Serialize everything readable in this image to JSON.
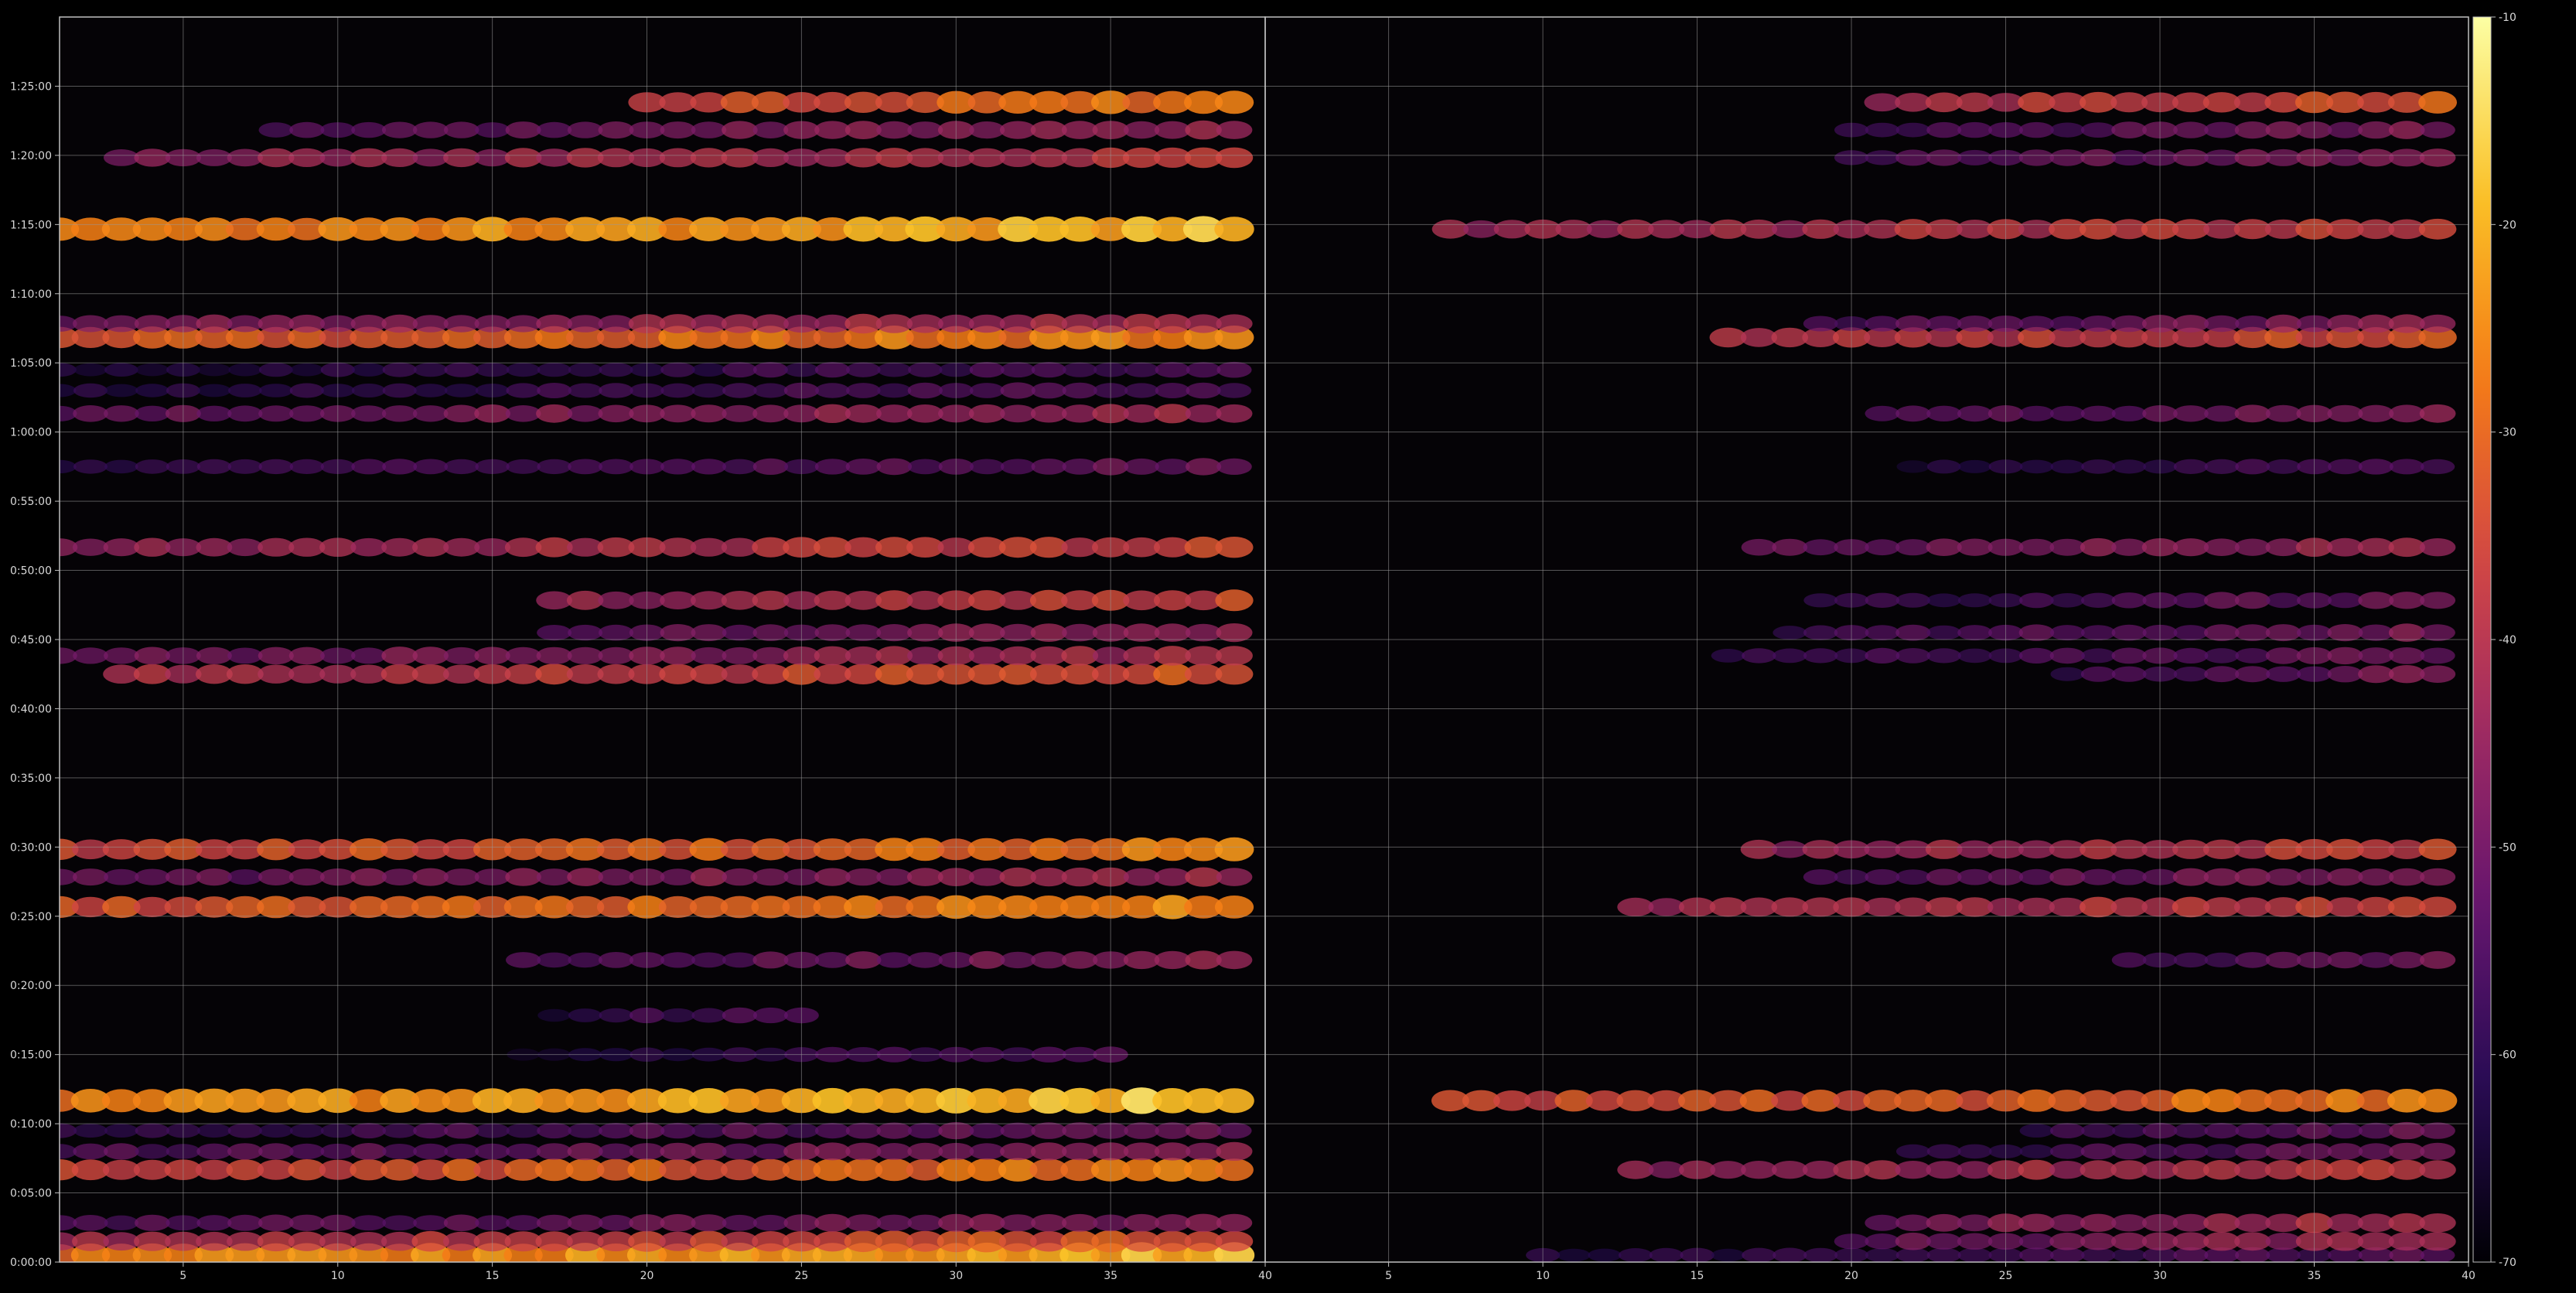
{
  "chart_data": {
    "type": "heatmap",
    "title": "",
    "colormap": "inferno",
    "colors": {
      "background": "#000000",
      "frame": "#bfbfbf",
      "grid": "#9a9a9a",
      "text": "#d8d8d8"
    },
    "grid": true,
    "y_axis": {
      "label": "",
      "range_seconds": [
        0,
        5400
      ],
      "tick_labels": [
        "0:00:00",
        "0:05:00",
        "0:10:00",
        "0:15:00",
        "0:20:00",
        "0:25:00",
        "0:30:00",
        "0:35:00",
        "0:40:00",
        "0:45:00",
        "0:50:00",
        "0:55:00",
        "1:00:00",
        "1:05:00",
        "1:10:00",
        "1:15:00",
        "1:20:00",
        "1:25:00"
      ]
    },
    "panels": [
      {
        "name": "",
        "x_range": [
          1,
          40
        ],
        "x_tick_labels": [
          "5",
          "10",
          "15",
          "20",
          "25",
          "30",
          "35",
          "40"
        ],
        "bands": [
          {
            "t": "0:00:30",
            "x": [
              1,
              39
            ],
            "level": -22
          },
          {
            "t": "0:01:30",
            "x": [
              1,
              39
            ],
            "level": -35
          },
          {
            "t": "0:02:50",
            "x": [
              1,
              39
            ],
            "level": -48
          },
          {
            "t": "0:06:40",
            "x": [
              1,
              39
            ],
            "level": -30
          },
          {
            "t": "0:08:00",
            "x": [
              1,
              39
            ],
            "level": -48
          },
          {
            "t": "0:09:30",
            "x": [
              1,
              39
            ],
            "level": -52
          },
          {
            "t": "0:11:40",
            "x": [
              1,
              39
            ],
            "level": -20
          },
          {
            "t": "0:15:00",
            "x": [
              16,
              35
            ],
            "level": -56
          },
          {
            "t": "0:17:50",
            "x": [
              17,
              25
            ],
            "level": -54
          },
          {
            "t": "0:21:50",
            "x": [
              16,
              39
            ],
            "level": -48
          },
          {
            "t": "0:25:40",
            "x": [
              1,
              39
            ],
            "level": -28
          },
          {
            "t": "0:27:50",
            "x": [
              1,
              39
            ],
            "level": -45
          },
          {
            "t": "0:29:50",
            "x": [
              1,
              39
            ],
            "level": -30
          },
          {
            "t": "0:42:30",
            "x": [
              3,
              39
            ],
            "level": -35
          },
          {
            "t": "0:43:50",
            "x": [
              1,
              39
            ],
            "level": -44
          },
          {
            "t": "0:45:30",
            "x": [
              17,
              39
            ],
            "level": -45
          },
          {
            "t": "0:47:50",
            "x": [
              17,
              39
            ],
            "level": -38
          },
          {
            "t": "0:51:40",
            "x": [
              1,
              39
            ],
            "level": -38
          },
          {
            "t": "0:57:30",
            "x": [
              1,
              39
            ],
            "level": -52
          },
          {
            "t": "1:01:20",
            "x": [
              1,
              39
            ],
            "level": -44
          },
          {
            "t": "1:03:00",
            "x": [
              1,
              39
            ],
            "level": -55
          },
          {
            "t": "1:04:30",
            "x": [
              1,
              39
            ],
            "level": -56
          },
          {
            "t": "1:06:50",
            "x": [
              1,
              39
            ],
            "level": -28
          },
          {
            "t": "1:07:50",
            "x": [
              1,
              39
            ],
            "level": -42
          },
          {
            "t": "1:14:40",
            "x": [
              1,
              39
            ],
            "level": -22
          },
          {
            "t": "1:19:50",
            "x": [
              3,
              39
            ],
            "level": -40
          },
          {
            "t": "1:21:50",
            "x": [
              8,
              39
            ],
            "level": -46
          },
          {
            "t": "1:23:50",
            "x": [
              20,
              39
            ],
            "level": -30
          }
        ]
      },
      {
        "name": "",
        "x_range": [
          1,
          40
        ],
        "x_tick_labels": [
          "5",
          "10",
          "15",
          "20",
          "25",
          "30",
          "35",
          "40"
        ],
        "bands": [
          {
            "t": "0:00:30",
            "x": [
              10,
              39
            ],
            "level": -55
          },
          {
            "t": "0:01:30",
            "x": [
              20,
              39
            ],
            "level": -45
          },
          {
            "t": "0:02:50",
            "x": [
              21,
              39
            ],
            "level": -42
          },
          {
            "t": "0:06:40",
            "x": [
              13,
              39
            ],
            "level": -40
          },
          {
            "t": "0:08:00",
            "x": [
              22,
              39
            ],
            "level": -52
          },
          {
            "t": "0:09:30",
            "x": [
              26,
              39
            ],
            "level": -52
          },
          {
            "t": "0:11:40",
            "x": [
              7,
              39
            ],
            "level": -30
          },
          {
            "t": "0:21:50",
            "x": [
              29,
              39
            ],
            "level": -50
          },
          {
            "t": "0:25:40",
            "x": [
              13,
              39
            ],
            "level": -38
          },
          {
            "t": "0:27:50",
            "x": [
              19,
              39
            ],
            "level": -48
          },
          {
            "t": "0:29:50",
            "x": [
              17,
              39
            ],
            "level": -38
          },
          {
            "t": "0:42:30",
            "x": [
              27,
              39
            ],
            "level": -50
          },
          {
            "t": "0:43:50",
            "x": [
              16,
              39
            ],
            "level": -52
          },
          {
            "t": "0:45:30",
            "x": [
              18,
              39
            ],
            "level": -50
          },
          {
            "t": "0:47:50",
            "x": [
              19,
              39
            ],
            "level": -52
          },
          {
            "t": "0:51:40",
            "x": [
              17,
              39
            ],
            "level": -45
          },
          {
            "t": "0:57:30",
            "x": [
              22,
              39
            ],
            "level": -55
          },
          {
            "t": "1:01:20",
            "x": [
              21,
              39
            ],
            "level": -48
          },
          {
            "t": "1:06:50",
            "x": [
              16,
              39
            ],
            "level": -35
          },
          {
            "t": "1:07:50",
            "x": [
              19,
              39
            ],
            "level": -48
          },
          {
            "t": "1:14:40",
            "x": [
              7,
              39
            ],
            "level": -38
          },
          {
            "t": "1:19:50",
            "x": [
              20,
              39
            ],
            "level": -48
          },
          {
            "t": "1:21:50",
            "x": [
              20,
              39
            ],
            "level": -50
          },
          {
            "t": "1:23:50",
            "x": [
              21,
              39
            ],
            "level": -35
          }
        ]
      }
    ],
    "colorbar": {
      "range": [
        -70,
        -10
      ],
      "tick_labels": [
        "-10",
        "-20",
        "-30",
        "-40",
        "-50",
        "-60",
        "-70"
      ]
    }
  }
}
